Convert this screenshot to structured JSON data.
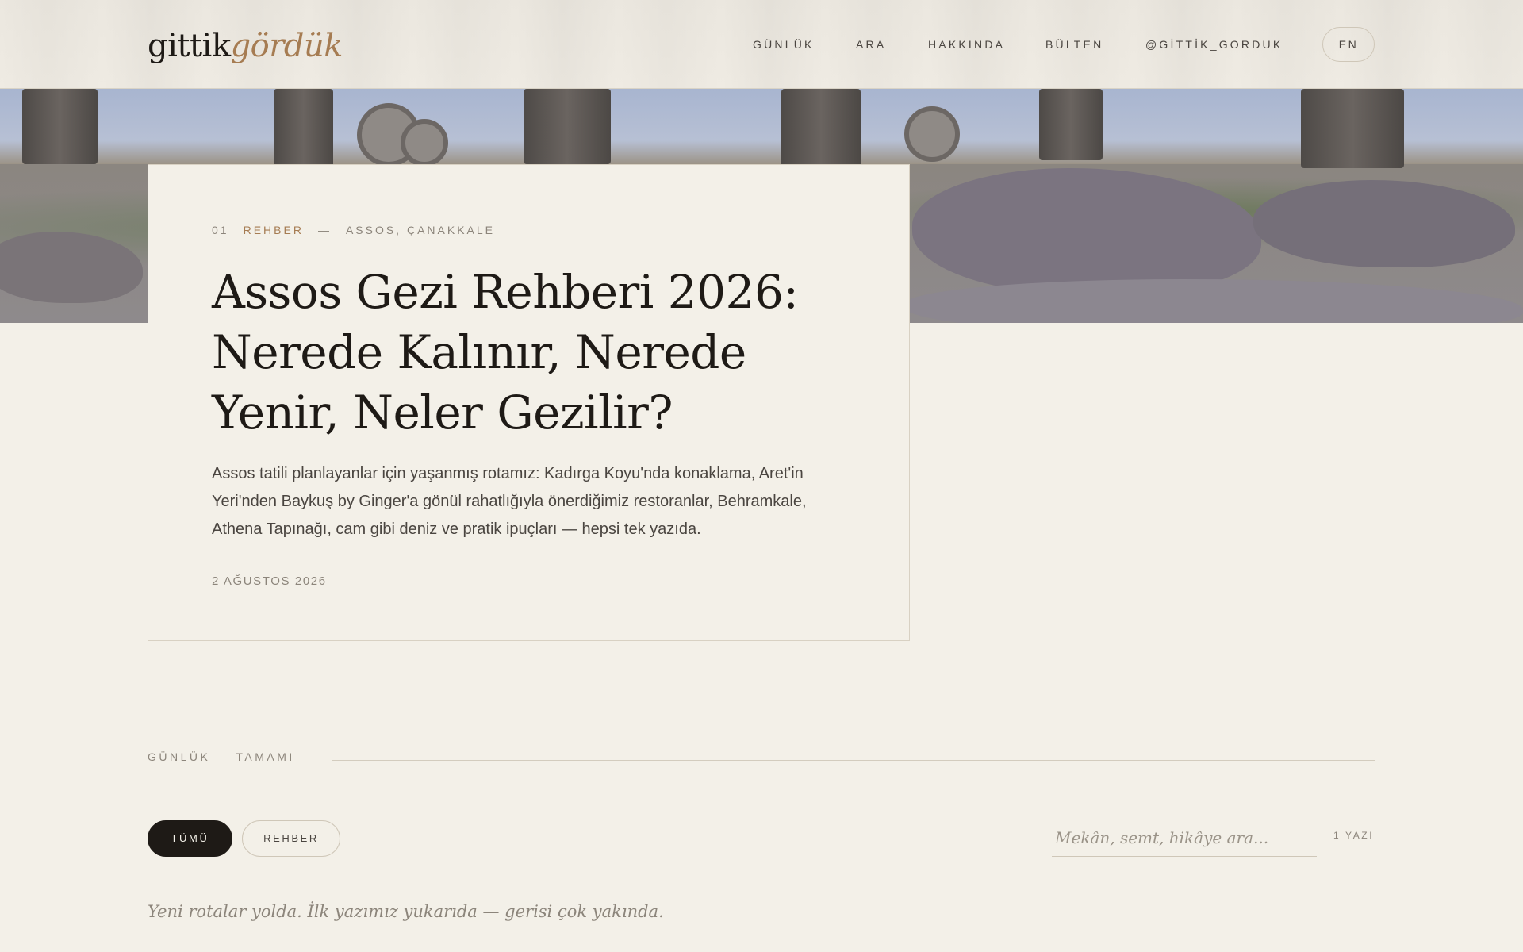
{
  "header": {
    "logo_part1": "gittik",
    "logo_part2": "gördük",
    "nav": [
      "GÜNLÜK",
      "ARA",
      "HAKKINDA",
      "BÜLTEN",
      "@GİTTİK_GORDUK"
    ],
    "lang": "EN"
  },
  "featured": {
    "number": "01",
    "category": "REHBER",
    "dash": "—",
    "location": "ASSOS, ÇANAKKALE",
    "title": "Assos Gezi Rehberi 2026: Nerede Kalınır, Nerede Yenir, Neler Gezilir?",
    "excerpt": "Assos tatili planlayanlar için yaşanmış rotamız: Kadırga Koyu'nda konaklama, Aret'in Yeri'nden Baykuş by Ginger'a gönül rahatlığıyla önerdiğimiz restoranlar, Behramkale, Athena Tapınağı, cam gibi deniz ve pratik ipuçları — hepsi tek yazıda.",
    "date": "2 AĞUSTOS 2026"
  },
  "section": {
    "label": "GÜNLÜK — TAMAMI",
    "filters": [
      "TÜMÜ",
      "REHBER"
    ],
    "search_placeholder": "Mekân, semt, hikâye ara...",
    "count": "1 YAZI",
    "empty_note": "Yeni rotalar yolda. İlk yazımız yukarıda — gerisi çok yakında."
  },
  "colors": {
    "background": "#f3f0e8",
    "accent": "#a67c52",
    "ink": "#1e1a16"
  }
}
